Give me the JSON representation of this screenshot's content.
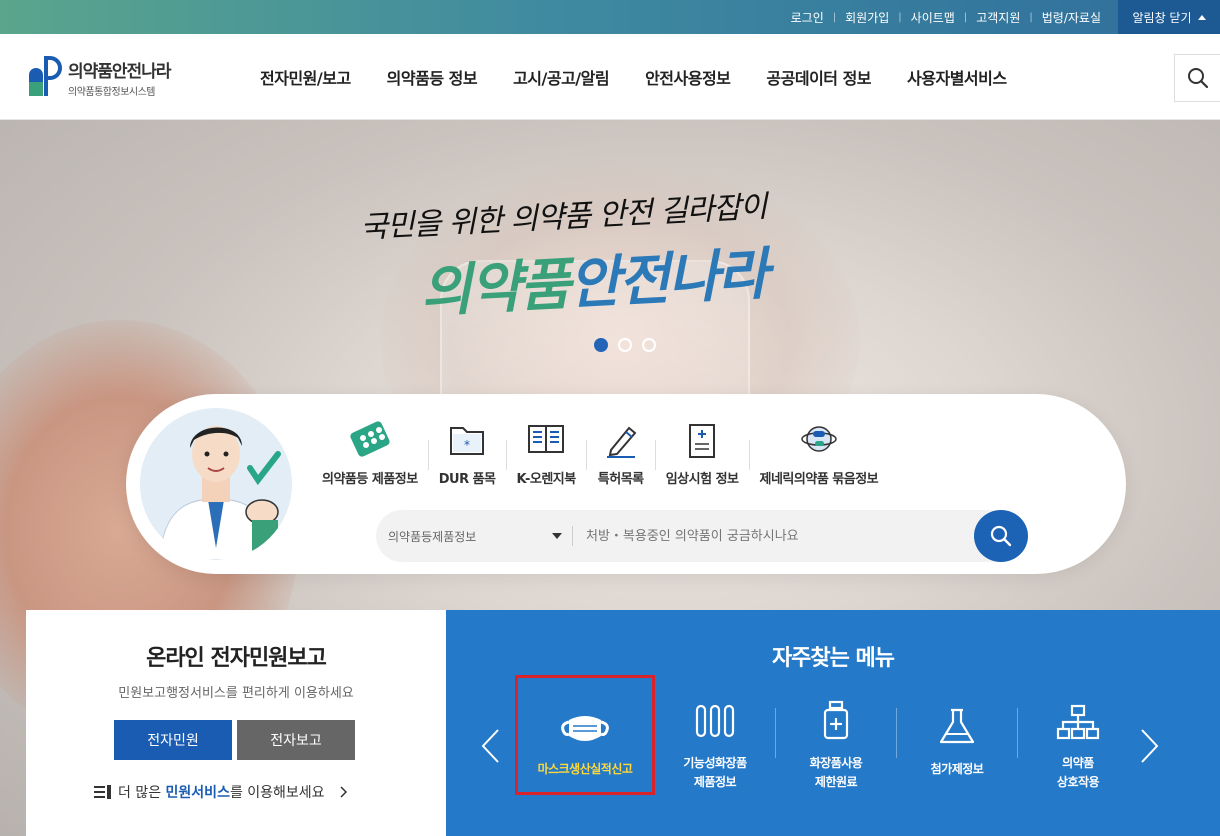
{
  "topbar": {
    "links": [
      "로그인",
      "회원가입",
      "사이트맵",
      "고객지원",
      "법령/자료실"
    ],
    "alert_close": "알림창 닫기"
  },
  "header": {
    "logo_title": "의약품안전나라",
    "logo_sub": "의약품통합정보시스템",
    "nav": [
      "전자민원/보고",
      "의약품등 정보",
      "고시/공고/알림",
      "안전사용정보",
      "공공데이터 정보",
      "사용자별서비스"
    ]
  },
  "hero": {
    "slogan": "국민을 위한 의약품 안전 길라잡이",
    "brand_part1": "의약품",
    "brand_part2": "안전나라"
  },
  "services": {
    "items": [
      {
        "label": "의약품등 제품정보",
        "icon": "pill-pack-icon"
      },
      {
        "label": "DUR 품목",
        "icon": "folder-medical-icon"
      },
      {
        "label": "K-오렌지북",
        "icon": "book-icon"
      },
      {
        "label": "특허목록",
        "icon": "pen-icon"
      },
      {
        "label": "임상시험 정보",
        "icon": "clipboard-icon"
      },
      {
        "label": "제네릭의약품 묶음정보",
        "icon": "globe-pills-icon"
      }
    ],
    "select_value": "의약품등제품정보",
    "search_placeholder": "처방・복용중인 의약품이 궁금하시나요"
  },
  "online": {
    "title": "온라인 전자민원보고",
    "subtitle": "민원보고행정서비스를 편리하게 이용하세요",
    "btn1": "전자민원",
    "btn2": "전자보고",
    "more_pre": "더 많은",
    "more_hl": "민원서비스",
    "more_post": "를 이용해보세요"
  },
  "quick": {
    "title": "자주찾는 메뉴",
    "items": [
      {
        "line1": "마스크생산실적신고",
        "line2": "",
        "icon": "mask-icon",
        "selected": true
      },
      {
        "line1": "기능성화장품",
        "line2": "제품정보",
        "icon": "test-tubes-icon"
      },
      {
        "line1": "화장품사용",
        "line2": "제한원료",
        "icon": "bottle-icon"
      },
      {
        "line1": "첨가제정보",
        "line2": "",
        "icon": "flask-icon"
      },
      {
        "line1": "의약품",
        "line2": "상호작용",
        "icon": "hierarchy-icon"
      }
    ]
  },
  "colors": {
    "primary": "#1a5cb2",
    "quick_bg": "#2479c9",
    "highlight": "#ffd83a",
    "select_outline": "#d8232a"
  }
}
